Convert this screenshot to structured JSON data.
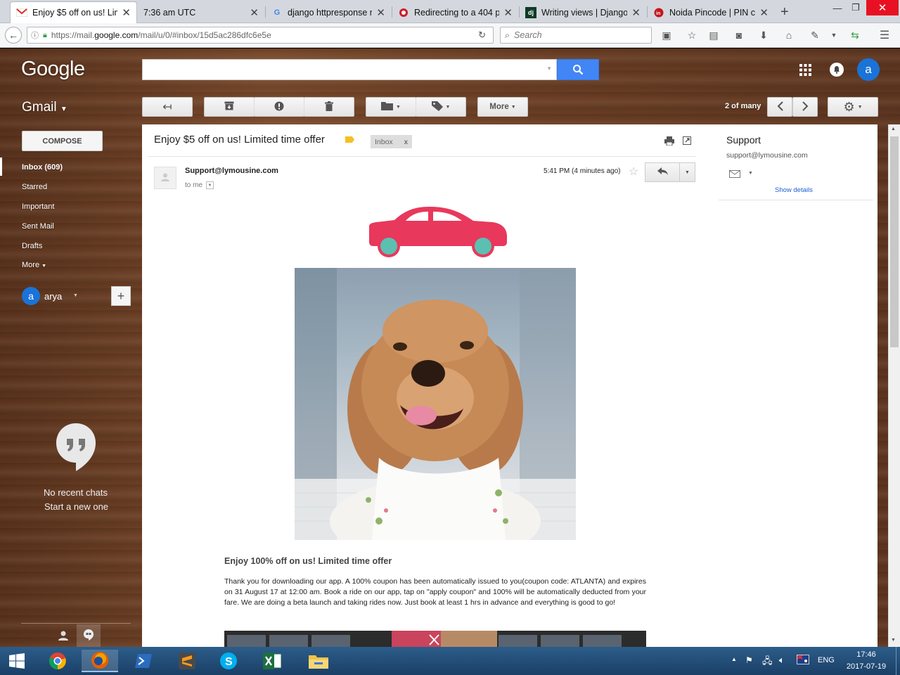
{
  "browser": {
    "tabs": [
      {
        "title": "Enjoy $5 off on us! Lim",
        "favicon": "gmail-icon",
        "active": true
      },
      {
        "title": "7:36 am UTC",
        "favicon": "",
        "active": false
      },
      {
        "title": "django httpresponse n",
        "favicon": "google-icon",
        "active": false
      },
      {
        "title": "Redirecting to a 404 pa",
        "favicon": "opera-icon",
        "active": false
      },
      {
        "title": "Writing views | Django",
        "favicon": "django-icon",
        "active": false
      },
      {
        "title": "Noida Pincode | PIN cc",
        "favicon": "pincode-icon",
        "active": false
      }
    ],
    "url_prefix": "https://mail.",
    "url_domain": "google.com",
    "url_path": "/mail/u/0/#inbox/15d5ac286dfc6e5e",
    "search_placeholder": "Search"
  },
  "gmail": {
    "logo": "Google",
    "app_label": "Gmail",
    "search_value": "",
    "avatar_letter": "a",
    "compose_label": "COMPOSE",
    "nav": [
      "Inbox (609)",
      "Starred",
      "Important",
      "Sent Mail",
      "Drafts",
      "More"
    ],
    "hangouts_user": "arya",
    "no_chats": "No recent chats",
    "start_new": "Start a new one",
    "toolbar_more": "More",
    "pagination": "2 of many"
  },
  "email": {
    "subject": "Enjoy $5 off on us! Limited time offer",
    "label": "Inbox",
    "label_remove": "x",
    "sender": "Support@lymousine.com",
    "to": "to me",
    "time": "5:41 PM (4 minutes ago)",
    "headline": "Enjoy 100% off on us! Limited time offer",
    "body": "Thank you for downloading our app. A 100% coupon has been automatically issued to you(coupon code: ATLANTA) and expires on 31 August 17 at 12:00 am. Book a ride on our app, tap on \"apply coupon\" and 100% will be automatically deducted from your fare. We are doing a beta launch and taking rides now. Just book at least 1 hrs in advance and everything is good to go!"
  },
  "contact": {
    "name": "Support",
    "email": "support@lymousine.com",
    "show_details": "Show details"
  },
  "taskbar": {
    "lang": "ENG",
    "time": "17:46",
    "date": "2017-07-19"
  },
  "colors": {
    "car": "#e8385c",
    "wheel": "#5bc0b2",
    "gmail_blue": "#4285f4",
    "avatar": "#1a73d8"
  }
}
